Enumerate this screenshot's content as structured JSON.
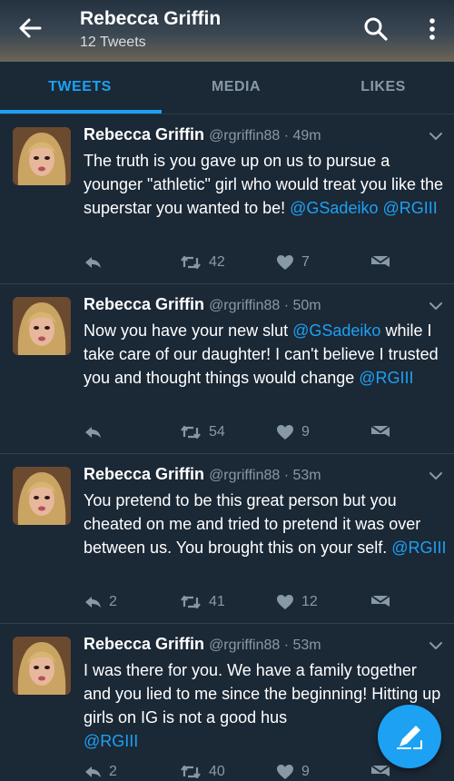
{
  "header": {
    "title": "Rebecca Griffin",
    "subtitle": "12 Tweets"
  },
  "tabs": [
    {
      "label": "TWEETS",
      "active": true
    },
    {
      "label": "MEDIA",
      "active": false
    },
    {
      "label": "LIKES",
      "active": false
    }
  ],
  "tweets": [
    {
      "name": "Rebecca Griffin",
      "handle_time": "@rgriffin88 · 49m",
      "text_plain": "The truth is you gave up on us to pursue a younger \"athletic\" girl who would treat you like the superstar you wanted to be! ",
      "mention1": "@GSadeiko",
      "mention2": "@RGIII",
      "reply_count": "",
      "retweet_count": "42",
      "like_count": "7"
    },
    {
      "name": "Rebecca Griffin",
      "handle_time": "@rgriffin88 · 50m",
      "text_plain": "Now you have your new slut ",
      "mention1": "@GSadeiko",
      "text_after": " while I take care of our daughter! I can't believe I trusted you and thought things would change ",
      "mention2": "@RGIII",
      "reply_count": "",
      "retweet_count": "54",
      "like_count": "9"
    },
    {
      "name": "Rebecca Griffin",
      "handle_time": "@rgriffin88 · 53m",
      "text_plain": "You pretend to be this great person but you cheated on me and tried to pretend it was over between us. You brought this on your self. ",
      "mention2": "@RGIII",
      "reply_count": "2",
      "retweet_count": "41",
      "like_count": "12"
    },
    {
      "name": "Rebecca Griffin",
      "handle_time": "@rgriffin88 · 53m",
      "text_plain": "I was there for you. We have a family together and you lied to me since the beginning! Hitting up girls on IG is not a good hus",
      "mention2": "@RGIII",
      "reply_count": "2",
      "retweet_count": "40",
      "like_count": "9"
    }
  ],
  "colors": {
    "background": "#1b2836",
    "accent": "#1da1f2",
    "muted": "#8899a6"
  },
  "icons": [
    "back-arrow-icon",
    "search-icon",
    "more-vertical-icon",
    "chevron-down-icon",
    "reply-icon",
    "retweet-icon",
    "heart-icon",
    "direct-message-icon",
    "compose-icon"
  ]
}
